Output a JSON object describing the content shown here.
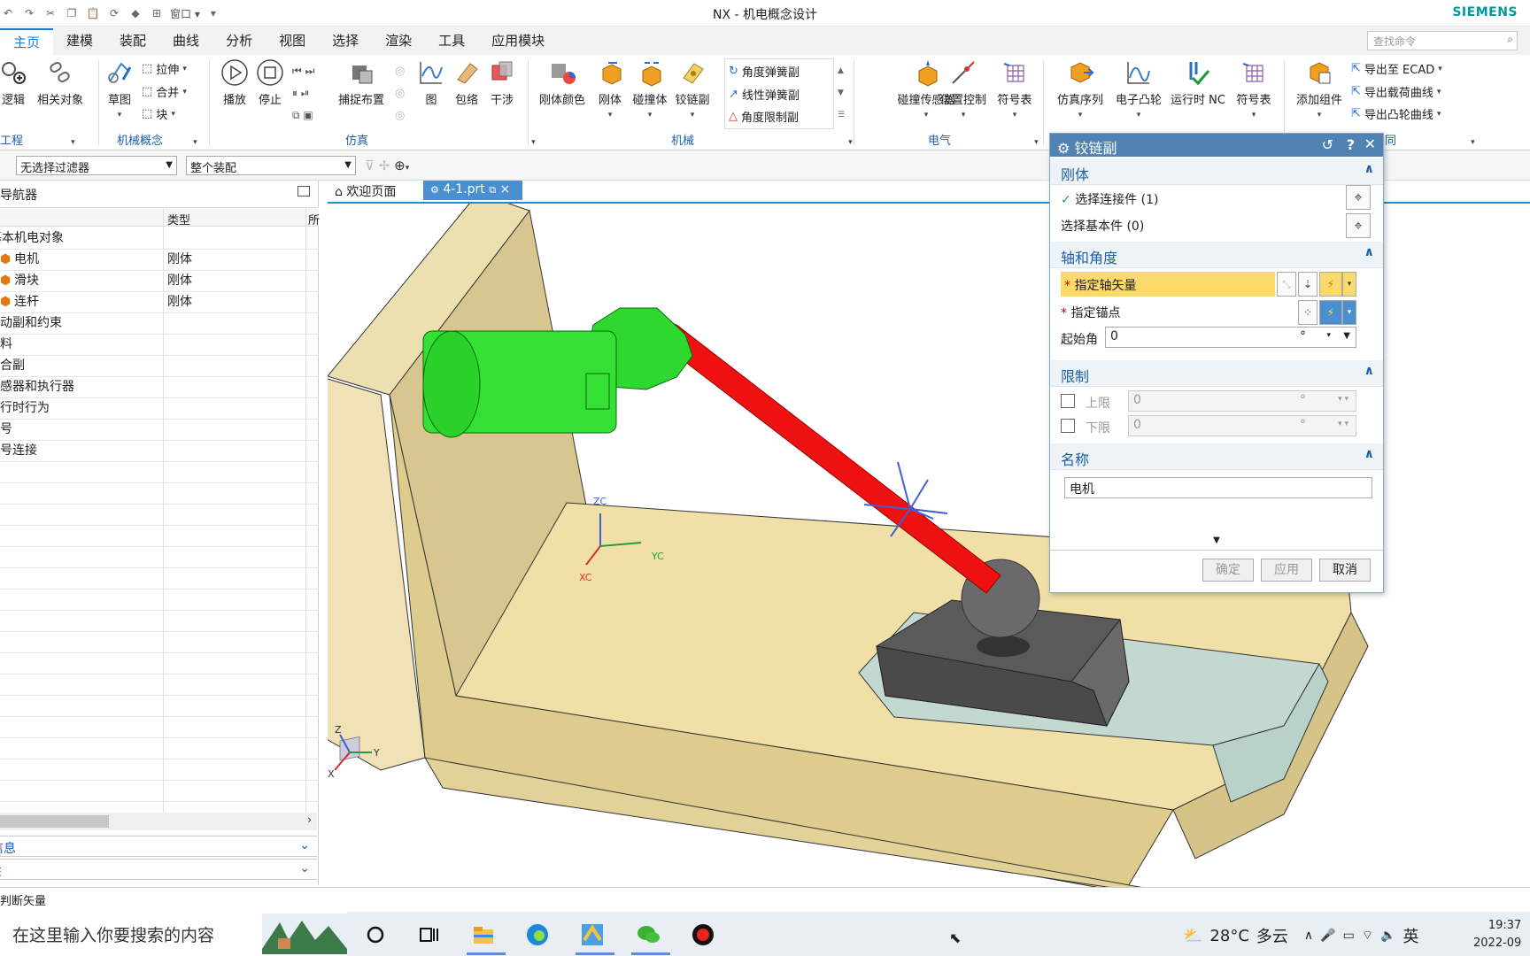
{
  "window": {
    "title": "NX - 机电概念设计",
    "brand": "SIEMENS",
    "qat_window_label": "窗口"
  },
  "ribbon": {
    "tabs": [
      "主页",
      "建模",
      "装配",
      "曲线",
      "分析",
      "视图",
      "选择",
      "渲染",
      "工具",
      "应用模块"
    ],
    "active_tab": "主页",
    "search_placeholder": "查找命令",
    "groups": {
      "project": {
        "label": "工程",
        "buttons": [
          "逻辑",
          "相关对象"
        ]
      },
      "mech_concept": {
        "label": "机械概念",
        "buttons": [
          "草图"
        ],
        "small": [
          "拉伸",
          "合并",
          "块"
        ]
      },
      "simulation": {
        "label": "仿真",
        "buttons": [
          "播放",
          "停止",
          "捕捉布置",
          "图",
          "包络",
          "干涉"
        ]
      },
      "mechanical": {
        "label": "机械",
        "buttons": [
          "刚体颜色",
          "刚体",
          "碰撞体",
          "铰链副"
        ],
        "small": [
          "角度弹簧副",
          "线性弹簧副",
          "角度限制副"
        ]
      },
      "electrical": {
        "label": "电气",
        "buttons": [
          "碰撞传感器",
          "位置控制",
          "符号表"
        ]
      },
      "automation": {
        "buttons": [
          "仿真序列",
          "电子凸轮",
          "运行时 NC",
          "符号表"
        ]
      },
      "design_coord": {
        "label": "同",
        "buttons": [
          "添加组件"
        ],
        "small": [
          "导出至 ECAD",
          "导出载荷曲线",
          "导出凸轮曲线"
        ]
      }
    }
  },
  "selection_bar": {
    "filter": "无选择过滤器",
    "scope": "整个装配"
  },
  "navigator": {
    "title": "导航器",
    "col_type": "类型",
    "col_extra": "所",
    "rows": [
      {
        "name": "基本机电对象",
        "type": ""
      },
      {
        "name": "电机",
        "type": "刚体"
      },
      {
        "name": "滑块",
        "type": "刚体"
      },
      {
        "name": "连杆",
        "type": "刚体"
      },
      {
        "name": "运动副和约束",
        "type": ""
      },
      {
        "name": "材料",
        "type": ""
      },
      {
        "name": "耦合副",
        "type": ""
      },
      {
        "name": "传感器和执行器",
        "type": ""
      },
      {
        "name": "运行时行为",
        "type": ""
      },
      {
        "name": "信号",
        "type": ""
      },
      {
        "name": "信号连接",
        "type": ""
      }
    ],
    "panels": [
      "信息",
      "性"
    ]
  },
  "doc_tabs": {
    "welcome": "欢迎页面",
    "file": "4-1.prt"
  },
  "viewport": {
    "axis_zc": "ZC",
    "axis_xc": "XC",
    "axis_yc": "YC",
    "tri_z": "Z",
    "tri_y": "Y",
    "tri_x": "X"
  },
  "dialog": {
    "title": "铰链副",
    "rigid": {
      "header": "刚体",
      "connect": "选择连接件 (1)",
      "base": "选择基本件 (0)"
    },
    "axis": {
      "header": "轴和角度",
      "vector": "指定轴矢量",
      "anchor": "指定锚点",
      "start_label": "起始角",
      "start_value": "0",
      "unit": "°"
    },
    "limit": {
      "header": "限制",
      "upper": "上限",
      "upper_value": "0",
      "lower": "下限",
      "lower_value": "0",
      "unit": "°"
    },
    "name": {
      "header": "名称",
      "value": "电机"
    },
    "buttons": {
      "ok": "确定",
      "apply": "应用",
      "cancel": "取消"
    }
  },
  "status": {
    "text": "自动判断矢量"
  },
  "taskbar": {
    "search": "在这里输入你要搜索的内容",
    "weather_temp": "28°C",
    "weather_desc": "多云",
    "ime": "英",
    "time": "19:37",
    "date": "2022-09"
  }
}
